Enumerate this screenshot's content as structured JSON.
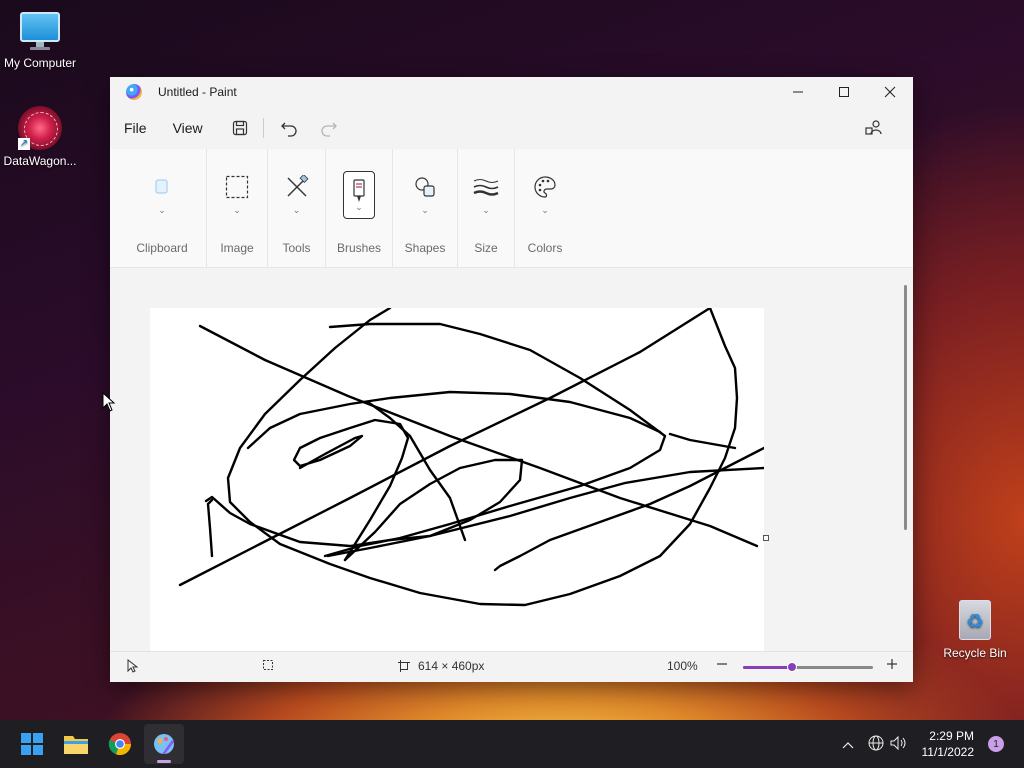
{
  "desktop": {
    "icons": [
      {
        "label": "My Computer"
      },
      {
        "label": "DataWagon..."
      },
      {
        "label": "Recycle Bin"
      }
    ]
  },
  "window": {
    "title": "Untitled - Paint",
    "menu": {
      "file": "File",
      "view": "View"
    },
    "ribbon": {
      "groups": [
        {
          "label": "Clipboard",
          "icon": "clipboard-icon"
        },
        {
          "label": "Image",
          "icon": "select-icon"
        },
        {
          "label": "Tools",
          "icon": "tools-icon"
        },
        {
          "label": "Brushes",
          "icon": "brush-icon"
        },
        {
          "label": "Shapes",
          "icon": "shapes-icon"
        },
        {
          "label": "Size",
          "icon": "size-icon"
        },
        {
          "label": "Colors",
          "icon": "palette-icon"
        }
      ]
    },
    "status": {
      "canvas_size": "614 × 460px",
      "zoom": "100%",
      "zoom_fraction": 0.38
    }
  },
  "taskbar": {
    "apps": [
      "start-icon",
      "file-explorer-icon",
      "chrome-icon",
      "paint-icon"
    ],
    "clock_time": "2:29 PM",
    "clock_date": "11/1/2022",
    "notification_count": "1"
  },
  "colors": {
    "accent": "#8a3fb8",
    "stroke": "#000000"
  }
}
